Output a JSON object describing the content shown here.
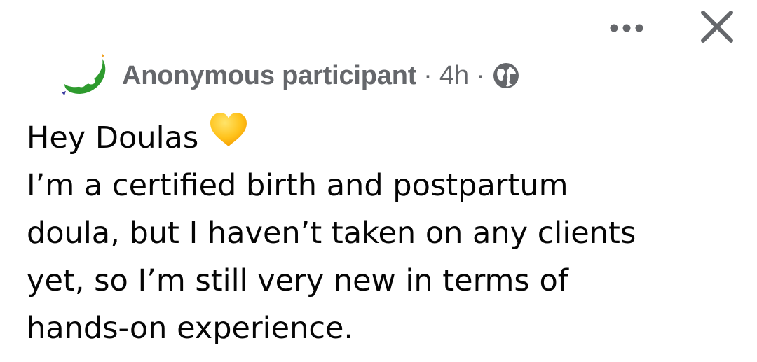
{
  "header": {
    "author": "Anonymous participant",
    "separator": "·",
    "time": "4h",
    "audience_icon": "globe-icon"
  },
  "toolbar": {
    "more_icon": "more-horizontal-icon",
    "close_icon": "close-icon"
  },
  "post": {
    "greeting": "Hey Doulas",
    "greeting_emoji": "yellow-heart-icon",
    "lines": [
      "I’m a certified birth and postpartum",
      "doula, but I haven’t taken on any clients",
      "yet, so I’m still very new in terms of",
      "hands-on experience."
    ]
  },
  "colors": {
    "secondary_text": "#65676b",
    "primary_text": "#050505",
    "avatar_green": "#2e9b2e",
    "heart": "#ffc21a"
  }
}
